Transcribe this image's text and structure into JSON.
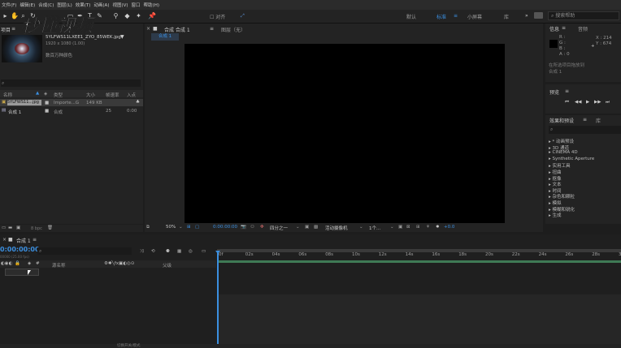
{
  "menu": [
    "文件(F)",
    "编辑(E)",
    "合成(C)",
    "图层(L)",
    "效果(T)",
    "动画(A)",
    "视图(V)",
    "窗口",
    "帮助(H)"
  ],
  "toolbar": {
    "snap_label": "对齐",
    "workspaces": [
      "默认",
      "标准",
      "小屏幕",
      "库"
    ],
    "active_workspace": "标准",
    "search_placeholder": "搜索帮助"
  },
  "project": {
    "tab": "项目",
    "file_name": "5YLFWS11LXEE1_ZYO_85WEK.jpg",
    "file_meta": "1920 x 1080 (1.00)",
    "file_uses": "数百万种颜色",
    "columns": [
      "名称",
      "类型",
      "大小",
      "帧速率",
      "入点"
    ],
    "rows": [
      {
        "name": "5YLFWS11...jpg",
        "type": "Importe...G",
        "size": "149 KB",
        "fps": "",
        "in": ""
      },
      {
        "name": "合成 1",
        "type": "合成",
        "size": "",
        "fps": "25",
        "in": "0:00"
      }
    ],
    "bpc": "8 bpc"
  },
  "composition": {
    "tab_label": "合成 合成 1",
    "layer_tab": "图层（无）",
    "subtab": "合成 1",
    "zoom": "50%",
    "timecode": "0:00:00:00",
    "resolution": "四分之一",
    "camera": "活动摄像机",
    "views": "1个...",
    "exposure": "+0.0"
  },
  "info": {
    "tab": "信息",
    "audio_tab": "音频",
    "r": "R :",
    "g": "G :",
    "b": "B :",
    "a": "A : 0",
    "x": "X : 214",
    "y": "Y : 674",
    "note": "在所选项目拖放到",
    "note2": "合成 1"
  },
  "preview": {
    "tab": "预览"
  },
  "effects": {
    "tab": "效果和预设",
    "lib_tab": "库",
    "items": [
      "* 动画预设",
      "3D 通道",
      "CINEMA 4D",
      "Synthetic Aperture",
      "实用工具",
      "扭曲",
      "抠像",
      "文本",
      "时间",
      "杂色和颗粒",
      "模拟",
      "模糊和锐化",
      "生成"
    ]
  },
  "timeline": {
    "tab": "合成 1",
    "timecode": "0:00:00:00",
    "fps_info": "00000 (25.00 fps)",
    "source_header": "源名称",
    "parent_header": "父级",
    "ticks": [
      "0f",
      "02s",
      "04s",
      "06s",
      "08s",
      "10s",
      "12s",
      "14s",
      "16s",
      "18s",
      "20s",
      "22s",
      "24s",
      "26s",
      "28s",
      "30s"
    ],
    "bottom_label": "切换开关/模式"
  },
  "colors": {
    "accent": "#3b8fe0",
    "playhead": "#3b8fe0",
    "work_area": "#3f7a55"
  }
}
